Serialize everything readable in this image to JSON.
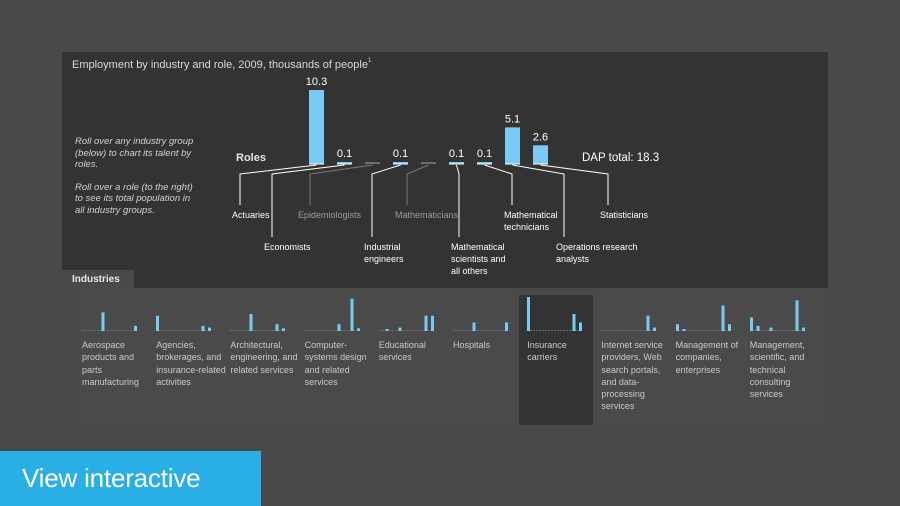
{
  "chart_data": {
    "type": "bar",
    "title": "Employment by industry and role, 2009, thousands of people",
    "title_footnote": "1",
    "xlabel": "Roles",
    "ylabel": "",
    "total_label": "DAP total: 18.3",
    "bar_color": "#79cbf4",
    "categories": [
      "Actuaries",
      "Economists",
      "Epidemiologists",
      "Industrial engineers",
      "Mathematicians",
      "Mathematical scientists and all others",
      "Mathematical technicians",
      "Operations research analysts",
      "Statisticians"
    ],
    "values": [
      10.3,
      0.1,
      0,
      0.1,
      0,
      0.1,
      0.1,
      5.1,
      2.6
    ],
    "value_labels": [
      "10.3",
      "0.1",
      "",
      "0.1",
      "",
      "0.1",
      "0.1",
      "5.1",
      "2.6"
    ],
    "active": [
      true,
      true,
      false,
      true,
      false,
      true,
      true,
      true,
      true
    ],
    "ylim": [
      0,
      10.3
    ],
    "selected_industry": "Insurance carriers"
  },
  "instructions": [
    "Roll over any industry group (below) to chart its talent by roles.",
    "Roll over a role (to the right) to see its total population in all industry groups."
  ],
  "industries_tab": "Industries",
  "industries": [
    {
      "label": "Aerospace products and parts manufacturing",
      "values": [
        0,
        0,
        0,
        0.55,
        0,
        0,
        0,
        0,
        0.15
      ],
      "selected": false
    },
    {
      "label": "Agencies, brokerages, and insurance-related activities",
      "values": [
        0.45,
        0,
        0,
        0,
        0,
        0,
        0,
        0.15,
        0.1
      ],
      "selected": false
    },
    {
      "label": "Architectural, engineering, and related services",
      "values": [
        0,
        0,
        0,
        0.5,
        0,
        0,
        0,
        0.2,
        0.08
      ],
      "selected": false
    },
    {
      "label": "Computer-systems design and related services",
      "values": [
        0,
        0,
        0,
        0,
        0,
        0.2,
        0,
        0.95,
        0.08
      ],
      "selected": false
    },
    {
      "label": "Educational services",
      "values": [
        0,
        0.05,
        0,
        0.1,
        0,
        0,
        0,
        0.45,
        0.45
      ],
      "selected": false
    },
    {
      "label": "Hospitals",
      "values": [
        0,
        0,
        0,
        0.25,
        0,
        0,
        0,
        0,
        0.25
      ],
      "selected": false
    },
    {
      "label": "Insurance carriers",
      "values": [
        1.0,
        0,
        0,
        0,
        0,
        0,
        0,
        0.5,
        0.25
      ],
      "selected": true
    },
    {
      "label": "Internet service providers, Web search portals, and data-processing services",
      "values": [
        0,
        0,
        0,
        0,
        0,
        0,
        0,
        0.45,
        0.1
      ],
      "selected": false
    },
    {
      "label": "Management of companies, enterprises",
      "values": [
        0.2,
        0.05,
        0,
        0,
        0,
        0,
        0,
        0.75,
        0.2
      ],
      "selected": false
    },
    {
      "label": "Management, scientific, and technical consulting services",
      "values": [
        0.4,
        0.15,
        0,
        0.1,
        0,
        0,
        0,
        0.9,
        0.1
      ],
      "selected": false
    }
  ],
  "cta": "View interactive"
}
